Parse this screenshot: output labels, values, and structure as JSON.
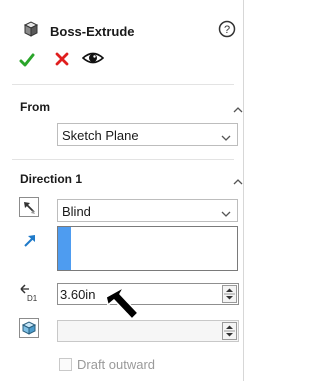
{
  "header": {
    "title": "Boss-Extrude",
    "feature_icon": "extrude-feature-icon",
    "help_icon": "help-icon"
  },
  "actions": {
    "ok_icon": "checkmark-icon",
    "cancel_icon": "close-icon",
    "preview_icon": "eye-icon"
  },
  "from": {
    "title": "From",
    "selected": "Sketch Plane"
  },
  "direction1": {
    "title": "Direction 1",
    "end_condition": "Blind",
    "depth_value": "3.60in",
    "draft_outward_label": "Draft outward",
    "draft_outward_checked": false
  },
  "colors": {
    "accent": "#4e9cf0",
    "ok": "#2aa52a",
    "cancel": "#e01e1e"
  }
}
